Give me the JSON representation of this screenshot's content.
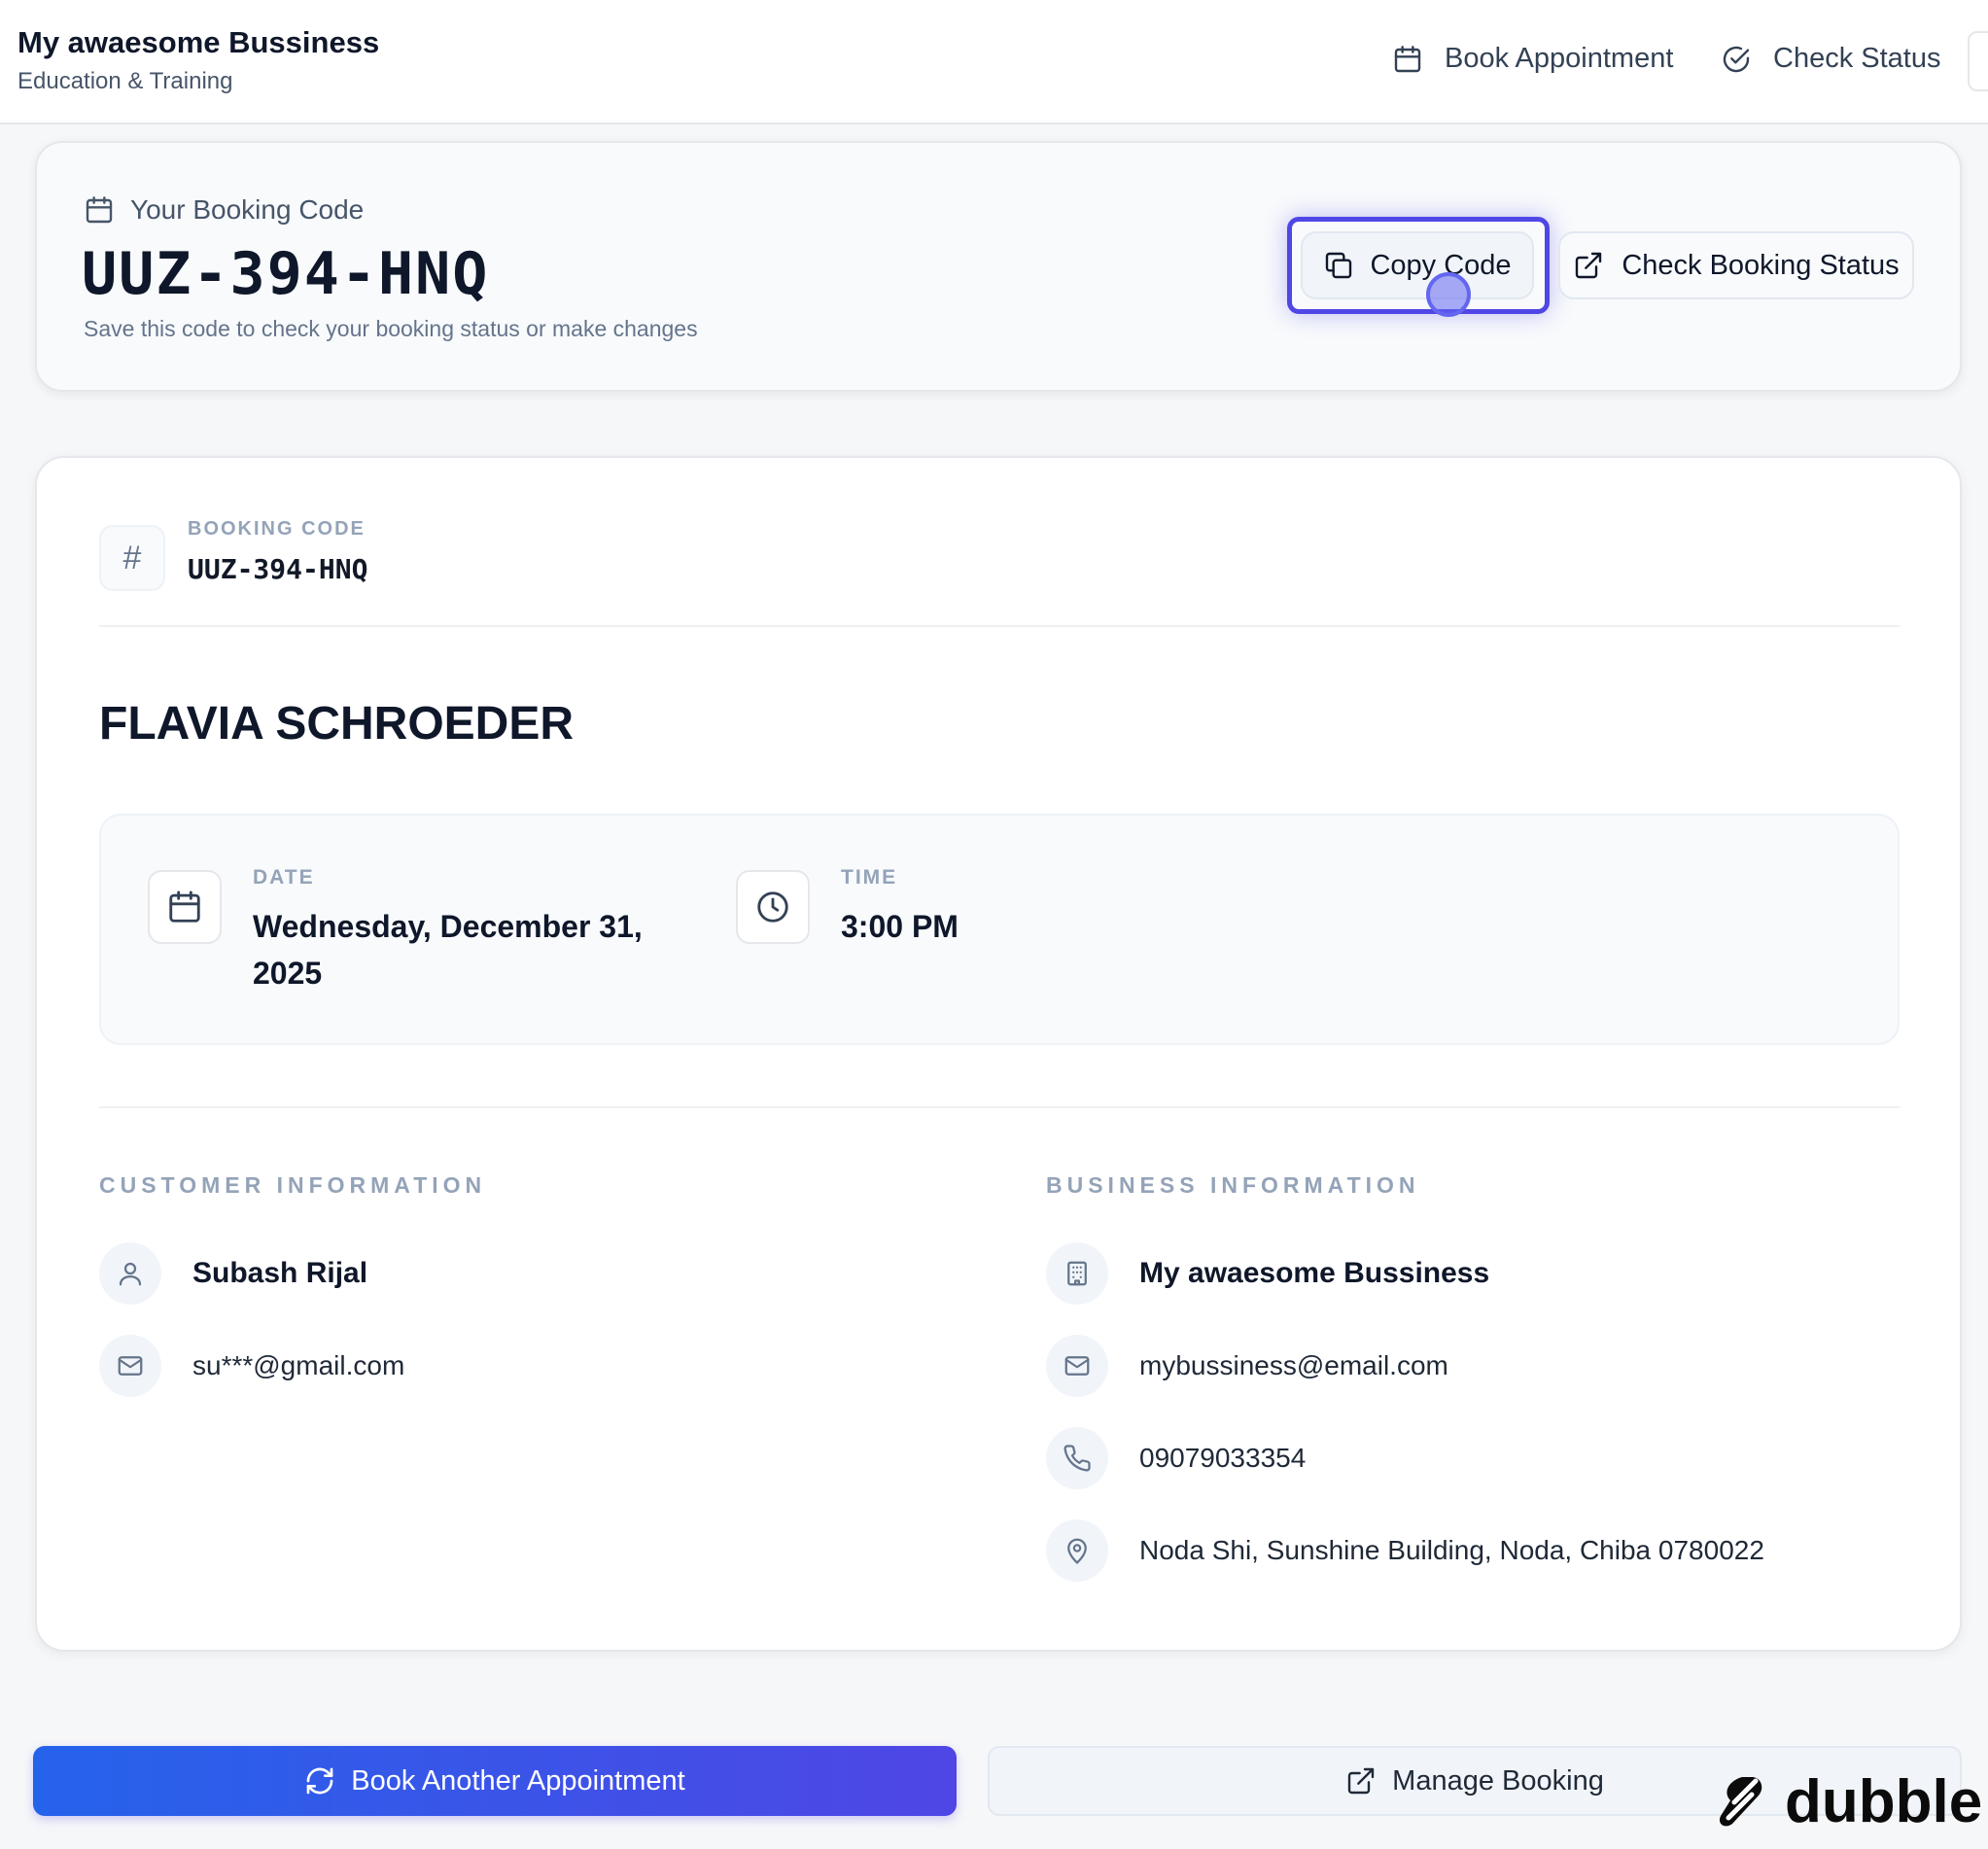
{
  "header": {
    "brand_title": "My awaesome Bussiness",
    "brand_subtitle": "Education & Training",
    "nav": [
      {
        "label": "Book Appointment",
        "icon": "calendar-icon"
      },
      {
        "label": "Check Status",
        "icon": "check-circle-icon"
      }
    ]
  },
  "code_card": {
    "label": "Your Booking Code",
    "code": "UUZ-394-HNQ",
    "hint": "Save this code to check your booking status or make changes",
    "copy_label": "Copy Code",
    "status_label": "Check Booking Status"
  },
  "booking": {
    "code_label": "BOOKING CODE",
    "code_value": "UUZ-394-HNQ",
    "service_title": "FLAVIA SCHROEDER",
    "date_label": "DATE",
    "date_value": "Wednesday, December 31, 2025",
    "time_label": "TIME",
    "time_value": "3:00 PM"
  },
  "customer": {
    "section_title": "CUSTOMER INFORMATION",
    "name": "Subash Rijal",
    "email": "su***@gmail.com"
  },
  "business": {
    "section_title": "BUSINESS INFORMATION",
    "name": "My awaesome Bussiness",
    "email": "mybussiness@email.com",
    "phone": "09079033354",
    "address": "Noda Shi, Sunshine Building, Noda, Chiba 0780022"
  },
  "actions": {
    "book_another": "Book Another Appointment",
    "manage": "Manage Booking"
  },
  "watermark": "dubble",
  "colors": {
    "accent": "#4f46e5",
    "primary_gradient_start": "#2563eb",
    "primary_gradient_end": "#4f46e5",
    "muted_label": "#94a3b8"
  }
}
